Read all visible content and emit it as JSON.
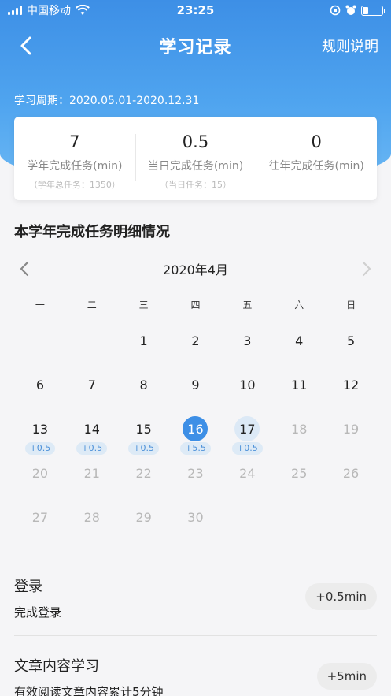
{
  "status_bar": {
    "carrier": "中国移动",
    "time": "23:25"
  },
  "nav": {
    "title": "学习记录",
    "rules_label": "规则说明"
  },
  "period": "学习周期：2020.05.01-2020.12.31",
  "stats": [
    {
      "value": "7",
      "label": "学年完成任务(min)",
      "sub": "（学年总任务：1350）"
    },
    {
      "value": "0.5",
      "label": "当日完成任务(min)",
      "sub": "（当日任务：15）"
    },
    {
      "value": "0",
      "label": "往年完成任务(min)",
      "sub": ""
    }
  ],
  "section_title": "本学年完成任务明细情况",
  "calendar": {
    "month_label": "2020年4月",
    "weekdays": [
      "一",
      "二",
      "三",
      "四",
      "五",
      "六",
      "日"
    ],
    "leading_blanks": 2,
    "days": [
      {
        "n": "1"
      },
      {
        "n": "2"
      },
      {
        "n": "3"
      },
      {
        "n": "4"
      },
      {
        "n": "5"
      },
      {
        "n": "6"
      },
      {
        "n": "7"
      },
      {
        "n": "8"
      },
      {
        "n": "9"
      },
      {
        "n": "10"
      },
      {
        "n": "11"
      },
      {
        "n": "12"
      },
      {
        "n": "13",
        "badge": "+0.5"
      },
      {
        "n": "14",
        "badge": "+0.5"
      },
      {
        "n": "15",
        "badge": "+0.5"
      },
      {
        "n": "16",
        "badge": "+5.5",
        "state": "selected"
      },
      {
        "n": "17",
        "badge": "+0.5",
        "state": "today"
      },
      {
        "n": "18",
        "state": "future"
      },
      {
        "n": "19",
        "state": "future"
      },
      {
        "n": "20",
        "state": "future"
      },
      {
        "n": "21",
        "state": "future"
      },
      {
        "n": "22",
        "state": "future"
      },
      {
        "n": "23",
        "state": "future"
      },
      {
        "n": "24",
        "state": "future"
      },
      {
        "n": "25",
        "state": "future"
      },
      {
        "n": "26",
        "state": "future"
      },
      {
        "n": "27",
        "state": "future"
      },
      {
        "n": "28",
        "state": "future"
      },
      {
        "n": "29",
        "state": "future"
      },
      {
        "n": "30",
        "state": "future"
      }
    ]
  },
  "tasks": [
    {
      "title": "登录",
      "desc": "完成登录",
      "button": "+0.5min"
    },
    {
      "title": "文章内容学习",
      "desc": "有效阅读文章内容累计5分钟",
      "button": "+5min"
    }
  ],
  "colors": {
    "accent": "#3d8fe6",
    "badge_bg": "#ddeaf6",
    "badge_text": "#4a8fd8"
  }
}
